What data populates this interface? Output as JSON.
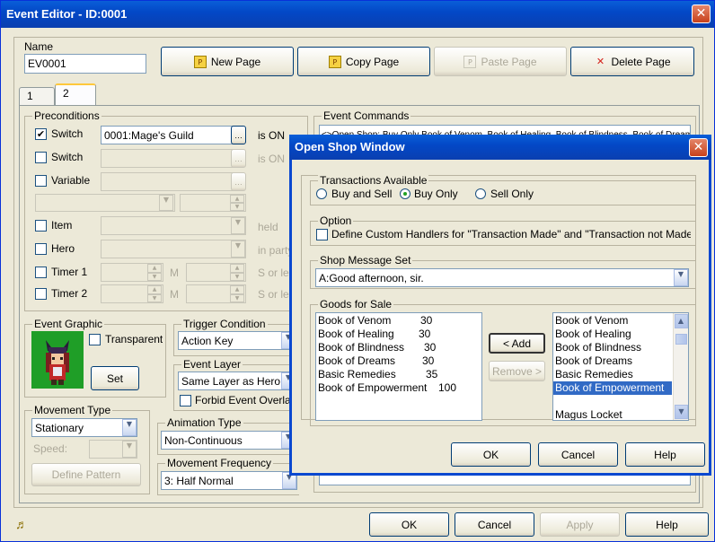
{
  "window": {
    "title": "Event Editor - ID:0001",
    "close": "✕"
  },
  "name_group": {
    "label": "Name",
    "value": "EV0001"
  },
  "toolbar": {
    "new_page": "New Page",
    "copy_page": "Copy Page",
    "paste_page": "Paste Page",
    "delete_page": "Delete Page"
  },
  "tabs": [
    "1",
    "2"
  ],
  "preconditions": {
    "label": "Preconditions",
    "switch1": {
      "label": "Switch",
      "checked": "✔",
      "value": "0001:Mage's Guild",
      "suffix": "is ON"
    },
    "switch2": {
      "label": "Switch",
      "suffix": "is ON"
    },
    "variable": {
      "label": "Variable"
    },
    "item": {
      "label": "Item",
      "suffix": "held"
    },
    "hero": {
      "label": "Hero",
      "suffix": "in party"
    },
    "timer1": {
      "label": "Timer 1",
      "m": "M",
      "suffix": "S or less"
    },
    "timer2": {
      "label": "Timer 2",
      "m": "M",
      "suffix": "S or less"
    }
  },
  "event_graphic": {
    "label": "Event Graphic",
    "transparent": "Transparent",
    "set": "Set"
  },
  "trigger": {
    "label": "Trigger Condition",
    "value": "Action Key"
  },
  "event_layer": {
    "label": "Event Layer",
    "value": "Same Layer as Hero",
    "forbid": "Forbid Event Overlap"
  },
  "movement_type": {
    "label": "Movement Type",
    "value": "Stationary",
    "speed_label": "Speed:",
    "define_pattern": "Define Pattern"
  },
  "animation_type": {
    "label": "Animation Type",
    "value": "Non-Continuous"
  },
  "movement_frequency": {
    "label": "Movement Frequency",
    "value": "3: Half Normal"
  },
  "event_commands": {
    "label": "Event Commands",
    "first_line": "<>Open Shop: Buy Only Book of Venom, Book of Healing, Book of Blindness, Book of Dreams"
  },
  "bottom": {
    "ok": "OK",
    "cancel": "Cancel",
    "apply": "Apply",
    "help": "Help",
    "music_icon": "♬"
  },
  "shop": {
    "title": "Open Shop Window",
    "transactions": {
      "label": "Transactions Available",
      "buy_sell": "Buy and Sell",
      "buy_only": "Buy Only",
      "sell_only": "Sell Only"
    },
    "option": {
      "label": "Option",
      "handlers": "Define Custom Handlers for \"Transaction Made\" and \"Transaction not Made\""
    },
    "message_set": {
      "label": "Shop Message Set",
      "value": "A:Good afternoon, sir."
    },
    "goods": {
      "label": "Goods for Sale",
      "left": [
        {
          "name": "Book of Venom",
          "price": "30"
        },
        {
          "name": "Book of Healing",
          "price": "30"
        },
        {
          "name": "Book of Blindness",
          "price": "30"
        },
        {
          "name": "Book of Dreams",
          "price": "30"
        },
        {
          "name": "Basic Remedies",
          "price": "35"
        },
        {
          "name": "Book of Empowerment",
          "price": "100"
        }
      ],
      "add": "< Add",
      "remove": "Remove >",
      "right": [
        "Book of Venom",
        "Book of Healing",
        "Book of Blindness",
        "Book of Dreams",
        "Basic Remedies",
        "Book of Empowerment",
        "",
        "Magus Locket"
      ]
    },
    "ok": "OK",
    "cancel": "Cancel",
    "help": "Help"
  }
}
